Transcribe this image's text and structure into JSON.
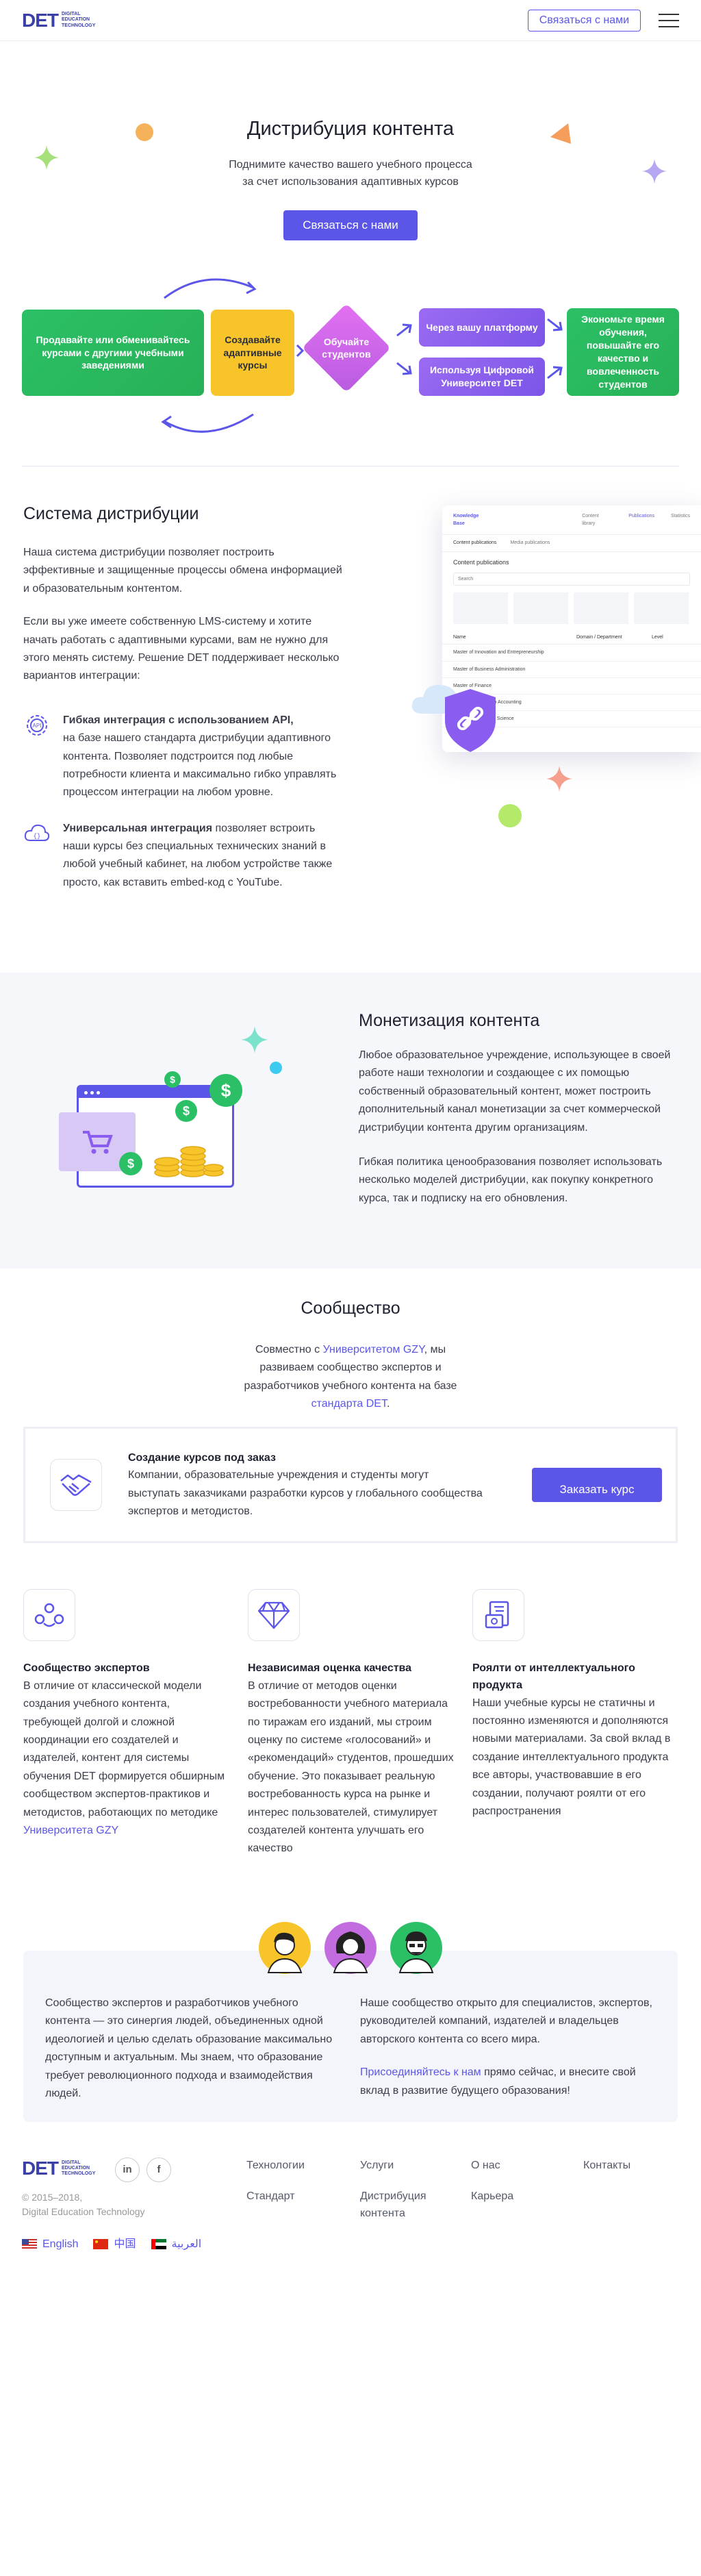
{
  "header": {
    "logo_mark": "DET",
    "logo_line1": "DIGITAL",
    "logo_line2": "EDUCATION",
    "logo_line3": "TECHNOLOGY",
    "cta": "Связаться с нами"
  },
  "hero": {
    "title": "Дистрибуция контента",
    "subtitle_1": "Поднимите качество вашего учебного процесса",
    "subtitle_2": "за счет использования адаптивных курсов",
    "cta": "Связаться с нами"
  },
  "flow": {
    "box1": "Продавайте или обменивайтесь курсами с другими учебными заведениями",
    "box2": "Создавайте адаптивные курсы",
    "box3": "Обучайте студентов",
    "box4": "Через вашу платформу",
    "box5": "Используя Цифровой Университет DET",
    "box6": "Экономьте время обучения, повышайте его качество и вовлеченность студентов"
  },
  "distribution": {
    "title": "Система дистрибуции",
    "p1": "Наша система дистрибуции позволяет построить эффективные и защищенные процессы обмена информацией и образовательным контентом.",
    "p2": "Если вы уже имеете собственную LMS-систему и хотите начать работать с адаптивными курсами, вам не нужно для этого менять систему. Решение DET поддерживает несколько вариантов интеграции:",
    "f1_title": "Гибкая интеграция с использованием API,",
    "f1_text": "на базе нашего стандарта дистрибуции адаптивного контента. Позволяет подстроится под любые потребности клиента и максимально гибко управлять процессом интеграции на любом уровне.",
    "f2_title": "Универсальная интеграция",
    "f2_text": "позволяет встроить наши курсы без специальных технических знаний в любой учебный кабинет, на любом устройстве также просто, как вставить embed-код с YouTube.",
    "mock": {
      "brand": "Knowledge Base",
      "tab1": "Content library",
      "tab2": "Publications",
      "tab3": "Statistics",
      "sub1": "Content publications",
      "sub2": "Media publications",
      "heading": "Content publications",
      "search": "Search",
      "col1": "Name",
      "col2": "Domain / Department",
      "col3": "Level",
      "rows": [
        "Master of Innovation and Entrepreneurship",
        "Master of Business Administration",
        "Master of Finance",
        "Master of Science in Accounting",
        "Master of Computer Science"
      ]
    }
  },
  "monetization": {
    "title": "Монетизация контента",
    "p1": "Любое образовательное учреждение, использующее в своей работе наши технологии и создающее с их помощью собственный образовательный контент, может построить дополнительный канал монетизации за счет коммерческой дистрибуции контента другим организациям.",
    "p2": "Гибкая политика ценообразования позволяет использовать несколько моделей дистрибуции, как покупку конкретного курса, так и подписку на его обновления.",
    "coin_symbol": "$"
  },
  "community": {
    "title": "Сообщество",
    "intro_1": "Совместно с ",
    "intro_link1": "Университетом GZY",
    "intro_2": ", мы развиваем сообщество экспертов и разработчиков учебного контента на базе ",
    "intro_link2": "стандарта DET",
    "intro_3": ".",
    "order_title": "Создание курсов под заказ",
    "order_text": "Компании, образовательные учреждения и студенты могут выступать заказчиками разработки курсов у глобального сообщества экспертов и методистов.",
    "order_cta": "Заказать курс",
    "pillars": [
      {
        "title": "Сообщество экспертов",
        "text": "В отличие от классической модели создания учебного контента, требующей долгой и сложной координации его создателей и издателей, контент для системы обучения DET формируется обширным сообществом экспертов-практиков и методистов, работающих по методике ",
        "link": "Университета GZY"
      },
      {
        "title": "Независимая оценка качества",
        "text": "В отличие от методов оценки востребованности учебного материала по тиражам его изданий, мы строим оценку по системе «голосований» и «рекомендаций» студентов, прошедших обучение. Это показывает реальную востребованность курса на рынке и интерес пользователей, стимулирует создателей контента улучшать его качество"
      },
      {
        "title": "Роялти от интеллектуального продукта",
        "text": "Наши учебные курсы не статичны и постоянно изменяются и дополняются новыми материалами. За свой вклад в создание интеллектуального продукта все авторы, участвовавшие в его создании, получают роялти от его распространения"
      }
    ],
    "bottom_left": "Сообщество экспертов и разработчиков учебного контента — это синергия людей, объединенных одной идеологией и целью сделать образование максимально доступным и актуальным. Мы знаем, что образование требует революционного подхода и взаимодействия людей.",
    "bottom_right_1": "Наше сообщество открыто для специалистов, экспертов, руководителей компаний, издателей и владельцев авторского контента со всего мира.",
    "bottom_link": "Присоединяйтесь к нам",
    "bottom_right_2": " прямо сейчас, и внесите свой вклад в развитие будущего образования!"
  },
  "footer": {
    "copyright_1": "© 2015–2018,",
    "copyright_2": "Digital Education Technology",
    "social_li": "in",
    "social_fb": "f",
    "nav": [
      [
        "Технологии",
        "Стандарт"
      ],
      [
        "Услуги",
        "Дистрибуция контента"
      ],
      [
        "О нас",
        "Карьера"
      ],
      [
        "Контакты"
      ]
    ],
    "langs": [
      "English",
      "中国",
      "العربية"
    ]
  },
  "colors": {
    "accent": "#5b56e8",
    "green": "#2cc066",
    "yellow": "#f7c52a",
    "purple": "#8a5ef0",
    "pink": "#d166ea"
  }
}
